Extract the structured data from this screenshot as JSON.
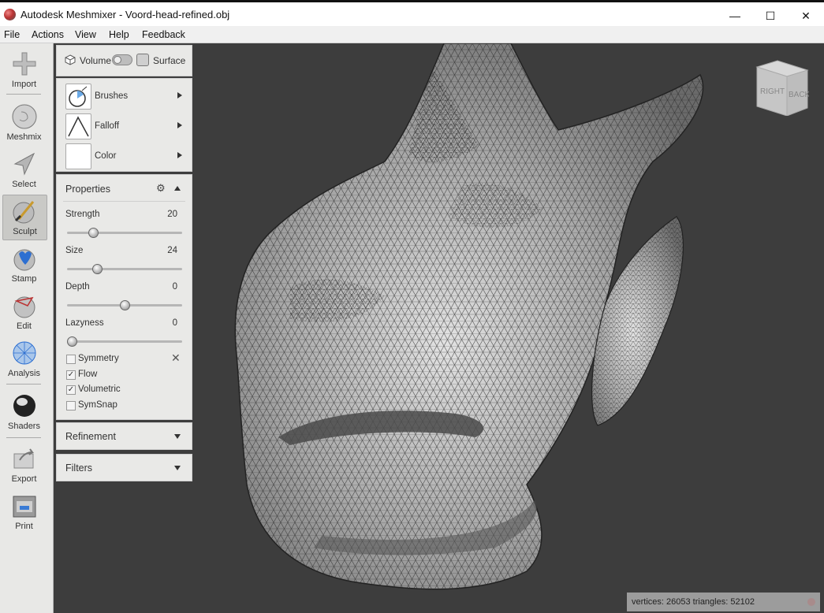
{
  "window": {
    "title": "Autodesk Meshmixer - Voord-head-refined.obj",
    "controls": {
      "minimize": "—",
      "maximize": "☐",
      "close": "✕"
    }
  },
  "menu": [
    "File",
    "Actions",
    "View",
    "Help",
    "Feedback"
  ],
  "toolbar": [
    {
      "label": "Import",
      "icon": "plus-icon"
    },
    {
      "label": "Meshmix",
      "icon": "meshmix-head-icon"
    },
    {
      "label": "Select",
      "icon": "select-arrow-icon"
    },
    {
      "label": "Sculpt",
      "icon": "sculpt-brush-icon",
      "active": true
    },
    {
      "label": "Stamp",
      "icon": "stamp-icon"
    },
    {
      "label": "Edit",
      "icon": "edit-sphere-icon"
    },
    {
      "label": "Analysis",
      "icon": "analysis-sphere-icon"
    },
    {
      "label": "Shaders",
      "icon": "shader-ball-icon"
    },
    {
      "label": "Export",
      "icon": "export-icon"
    },
    {
      "label": "Print",
      "icon": "printer-icon"
    }
  ],
  "mode": {
    "volume_label": "Volume",
    "surface_label": "Surface"
  },
  "brush_panel": {
    "brushes_label": "Brushes",
    "falloff_label": "Falloff",
    "color_label": "Color"
  },
  "properties": {
    "title": "Properties",
    "strength": {
      "label": "Strength",
      "value": "20",
      "fraction": 0.2
    },
    "size": {
      "label": "Size",
      "value": "24",
      "fraction": 0.24
    },
    "depth": {
      "label": "Depth",
      "value": "0",
      "fraction": 0.5
    },
    "lazyness": {
      "label": "Lazyness",
      "value": "0",
      "fraction": 0.0
    },
    "checkboxes": [
      {
        "label": "Symmetry",
        "checked": false
      },
      {
        "label": "Flow",
        "checked": true
      },
      {
        "label": "Volumetric",
        "checked": true
      },
      {
        "label": "SymSnap",
        "checked": false
      }
    ],
    "check_mark": "✓"
  },
  "refinement_title": "Refinement",
  "filters_title": "Filters",
  "viewcube": {
    "face_right": "RIGHT",
    "face_back": "BACK"
  },
  "status": {
    "text": "vertices: 26053 triangles: 52102"
  },
  "colors": {
    "viewport": "#3d3d3d",
    "panel": "#e9e9e7",
    "mesh": "#a9a9a9",
    "status_bar": "#9c9c9c"
  }
}
